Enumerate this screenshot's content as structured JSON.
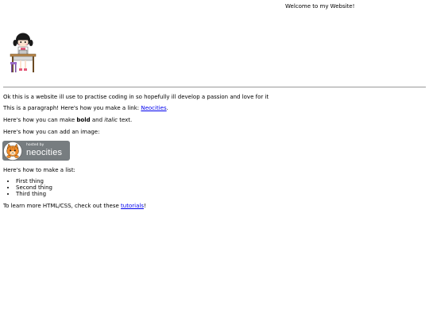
{
  "header": {
    "welcome": "Welcome to my Website!"
  },
  "intro": {
    "text": "Ok this is a website ill use to practise coding in so hopefully ill develop a passion and love for it"
  },
  "paragraph_link": {
    "before": "This is a paragraph! Here's how you make a link: ",
    "link": "Neocities",
    "after": "."
  },
  "formatting": {
    "before": "Here's how you can make ",
    "bold": "bold",
    "middle": " and ",
    "italic": "italic",
    "after": " text."
  },
  "image_intro": {
    "text": "Here's how you can add an image:"
  },
  "badge": {
    "small_text": "hosted by",
    "big_text": "neocities",
    "color": "#777d80"
  },
  "list_intro": {
    "text": "Here's how to make a list:"
  },
  "list": {
    "items": [
      "First thing",
      "Second thing",
      "Third thing"
    ]
  },
  "tutorials": {
    "before": "To learn more HTML/CSS, check out these ",
    "link": "tutorials",
    "after": "!"
  },
  "colors": {
    "link": "#0000ee",
    "divider": "#9a9a9a"
  }
}
